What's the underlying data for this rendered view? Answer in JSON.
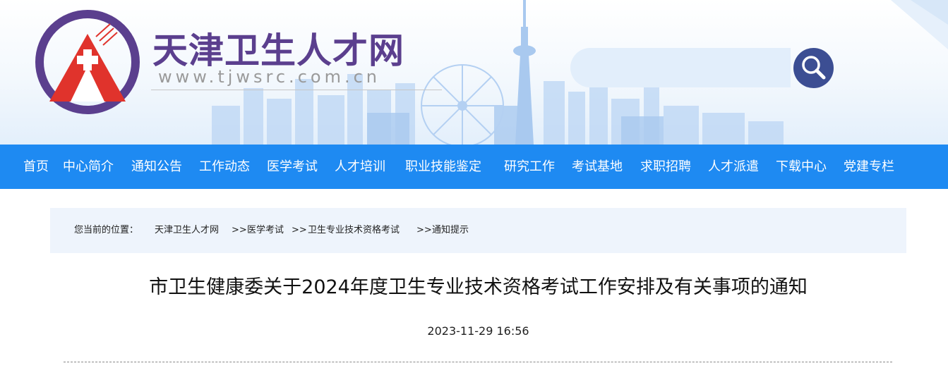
{
  "header": {
    "site_name": "天津卫生人才网",
    "site_url": "www.tjwsrc.com.cn",
    "search": {
      "placeholder": ""
    },
    "colors": {
      "brand_purple": "#5b3f8e",
      "nav_blue": "#1e8af2",
      "search_button": "#3c4e93",
      "logo_red": "#e0332c"
    }
  },
  "nav": {
    "items": [
      "首页",
      "中心简介",
      "通知公告",
      "工作动态",
      "医学考试",
      "人才培训",
      "职业技能鉴定",
      "研究工作",
      "考试基地",
      "求职招聘",
      "人才派遣",
      "下载中心",
      "党建专栏"
    ]
  },
  "breadcrumb": {
    "prefix": "您当前的位置：",
    "items": [
      "天津卫生人才网",
      "医学考试",
      "卫生专业技术资格考试",
      "通知提示"
    ],
    "separator": ">>"
  },
  "article": {
    "title": "市卫生健康委关于2024年度卫生专业技术资格考试工作安排及有关事项的通知",
    "date": "2023-11-29 16:56"
  }
}
